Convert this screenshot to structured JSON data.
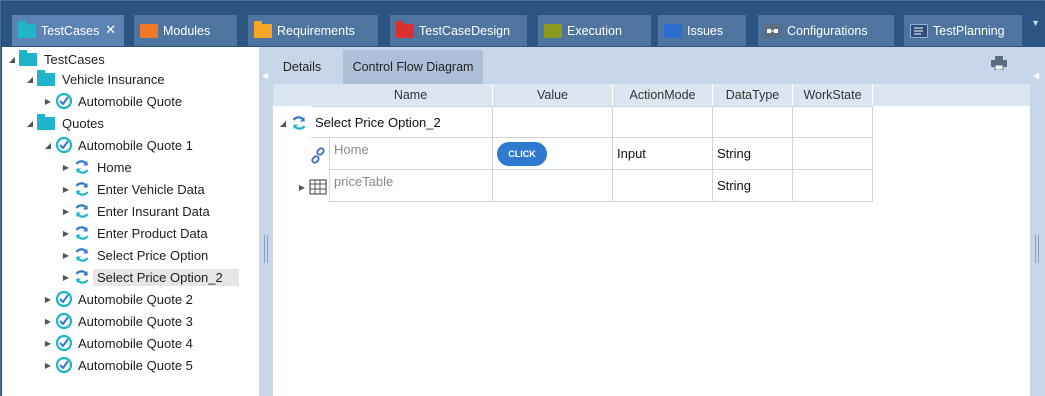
{
  "tabs": [
    {
      "label": "TestCases",
      "icon": "folder-icon",
      "color": "#1fb4c9",
      "active": true,
      "close": "✕"
    },
    {
      "label": "Modules",
      "icon": "module-icon",
      "color": "#f07a2a"
    },
    {
      "label": "Requirements",
      "icon": "folder-icon",
      "color": "#f5a623"
    },
    {
      "label": "TestCaseDesign",
      "icon": "folder-icon",
      "color": "#d93030"
    },
    {
      "label": "Execution",
      "icon": "execution-icon",
      "color": "#8a9a1e"
    },
    {
      "label": "Issues",
      "icon": "issues-icon",
      "color": "#2c6ccf"
    },
    {
      "label": "Configurations",
      "icon": "configurations-icon",
      "color": "#5a6d82"
    },
    {
      "label": "TestPlanning",
      "icon": "testplanning-icon",
      "color": "#2d4e7a"
    }
  ],
  "tree": {
    "root": "TestCases",
    "vehicle_insurance": "Vehicle Insurance",
    "automobile_quote": "Automobile Quote",
    "quotes": "Quotes",
    "aq1": "Automobile Quote 1",
    "children": [
      "Home",
      "Enter Vehicle Data",
      "Enter Insurant Data",
      "Enter Product Data",
      "Select Price Option",
      "Select Price Option_2"
    ],
    "aq2": "Automobile Quote 2",
    "aq3": "Automobile Quote 3",
    "aq4": "Automobile Quote 4",
    "aq5": "Automobile Quote 5"
  },
  "subtabs": {
    "details": "Details",
    "control_flow": "Control Flow Diagram"
  },
  "grid": {
    "headers": [
      "Name",
      "Value",
      "ActionMode",
      "DataType",
      "WorkState"
    ],
    "parent_row": "Select Price Option_2",
    "rows": [
      {
        "name": "Home",
        "value_button": "CLICK",
        "action_mode": "Input",
        "data_type": "String",
        "work_state": ""
      },
      {
        "name": "priceTable",
        "value": "",
        "action_mode": "",
        "data_type": "String",
        "work_state": ""
      }
    ]
  }
}
